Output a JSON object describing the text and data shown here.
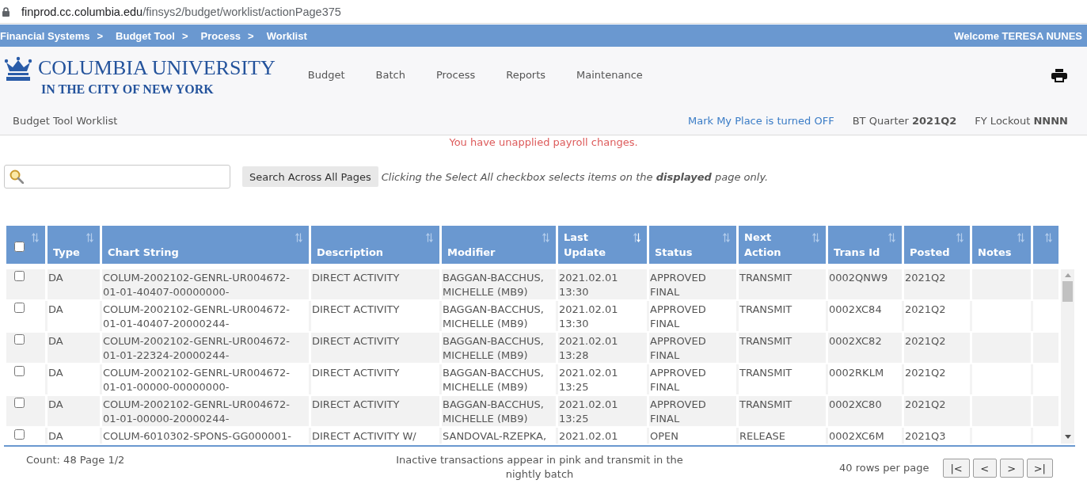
{
  "address_bar": {
    "host": "finprod.cc.columbia.edu",
    "path": "/finsys2/budget/worklist/actionPage375"
  },
  "breadcrumb": {
    "items": [
      {
        "label": "Financial Systems",
        "separator": ">"
      },
      {
        "label": "Budget Tool",
        "separator": ">"
      },
      {
        "label": "Process",
        "separator": ">"
      },
      {
        "label": "Worklist"
      }
    ],
    "welcome": "Welcome TERESA NUNES"
  },
  "header": {
    "logo": {
      "name": "COLUMBIA UNIVERSITY",
      "tagline": "IN THE CITY OF NEW YORK"
    },
    "nav": [
      "Budget",
      "Batch",
      "Process",
      "Reports",
      "Maintenance"
    ]
  },
  "subheader": {
    "title": "Budget Tool Worklist",
    "mark_my_place": "Mark My Place is turned OFF",
    "quarter": "BT Quarter **2021Q2**",
    "lockout": "FY Lockout **NNNN**"
  },
  "alert": "You have unapplied payroll changes.",
  "search": {
    "button": "Search Across All Pages",
    "hint": "Clicking the Select All checkbox selects items on the **displayed** page only."
  },
  "table": {
    "select_all": {
      "checked": false,
      "sorted": false
    },
    "columns": [
      {
        "kind": "text",
        "label": "Type",
        "sorted": false
      },
      {
        "kind": "code",
        "label": "Chart String",
        "sorted": false
      },
      {
        "kind": "text",
        "label": "Description",
        "sorted": false
      },
      {
        "kind": "text",
        "label": "Modifier",
        "sorted": false
      },
      {
        "kind": "text",
        "label": "Last Update",
        "sorted": true
      },
      {
        "kind": "text",
        "label": "Status",
        "sorted": false
      },
      {
        "kind": "text",
        "label": "Next Action",
        "sorted": false
      },
      {
        "kind": "text",
        "label": "Trans Id",
        "sorted": false
      },
      {
        "kind": "text",
        "label": "Posted",
        "sorted": false
      },
      {
        "label": "Notes",
        "sorted": false
      },
      {
        "sorted": false
      }
    ],
    "rows": [
      {
        "checked": false,
        "cells": [
          "DA",
          "COLUM-2002102-GENRL-UR004672-01-01-40407-00000000-",
          "DIRECT ACTIVITY",
          "BAGGAN-BACCHUS, MICHELLE (MB9)",
          "2021.02.01 13:30",
          "APPROVED FINAL",
          "TRANSMIT",
          "0002QNW9",
          "2021Q2"
        ]
      },
      {
        "checked": false,
        "cells": [
          "DA",
          "COLUM-2002102-GENRL-UR004672-01-01-40407-20000244-",
          "DIRECT ACTIVITY",
          "BAGGAN-BACCHUS, MICHELLE (MB9)",
          "2021.02.01 13:30",
          "APPROVED FINAL",
          "TRANSMIT",
          "0002XC84",
          "2021Q2"
        ]
      },
      {
        "checked": false,
        "cells": [
          "DA",
          "COLUM-2002102-GENRL-UR004672-01-01-22324-20000244-",
          "DIRECT ACTIVITY",
          "BAGGAN-BACCHUS, MICHELLE (MB9)",
          "2021.02.01 13:28",
          "APPROVED FINAL",
          "TRANSMIT",
          "0002XC82",
          "2021Q2"
        ]
      },
      {
        "checked": false,
        "cells": [
          "DA",
          "COLUM-2002102-GENRL-UR004672-01-01-00000-00000000-",
          "DIRECT ACTIVITY",
          "BAGGAN-BACCHUS, MICHELLE (MB9)",
          "2021.02.01 13:25",
          "APPROVED FINAL",
          "TRANSMIT",
          "0002RKLM",
          "2021Q2"
        ]
      },
      {
        "checked": false,
        "cells": [
          "DA",
          "COLUM-2002102-GENRL-UR004672-01-01-00000-20000244-",
          "DIRECT ACTIVITY",
          "BAGGAN-BACCHUS, MICHELLE (MB9)",
          "2021.02.01 13:25",
          "APPROVED FINAL",
          "TRANSMIT",
          "0002XC80",
          "2021Q2"
        ]
      },
      {
        "checked": false,
        "cells": [
          "DA",
          "COLUM-6010302-SPONS-GG000001-",
          "DIRECT ACTIVITY W/",
          "SANDOVAL-RZEPKA,",
          "2021.02.01",
          "OPEN",
          "RELEASE",
          "0002XC6M",
          "2021Q3"
        ]
      }
    ]
  },
  "footer": {
    "count": "Count: 48 Page 1/2",
    "note": "Inactive transactions appear in pink and transmit in the nightly batch",
    "rows_per_page": "40 rows per page",
    "pager": [
      "|<",
      "<",
      ">",
      ">|"
    ]
  }
}
